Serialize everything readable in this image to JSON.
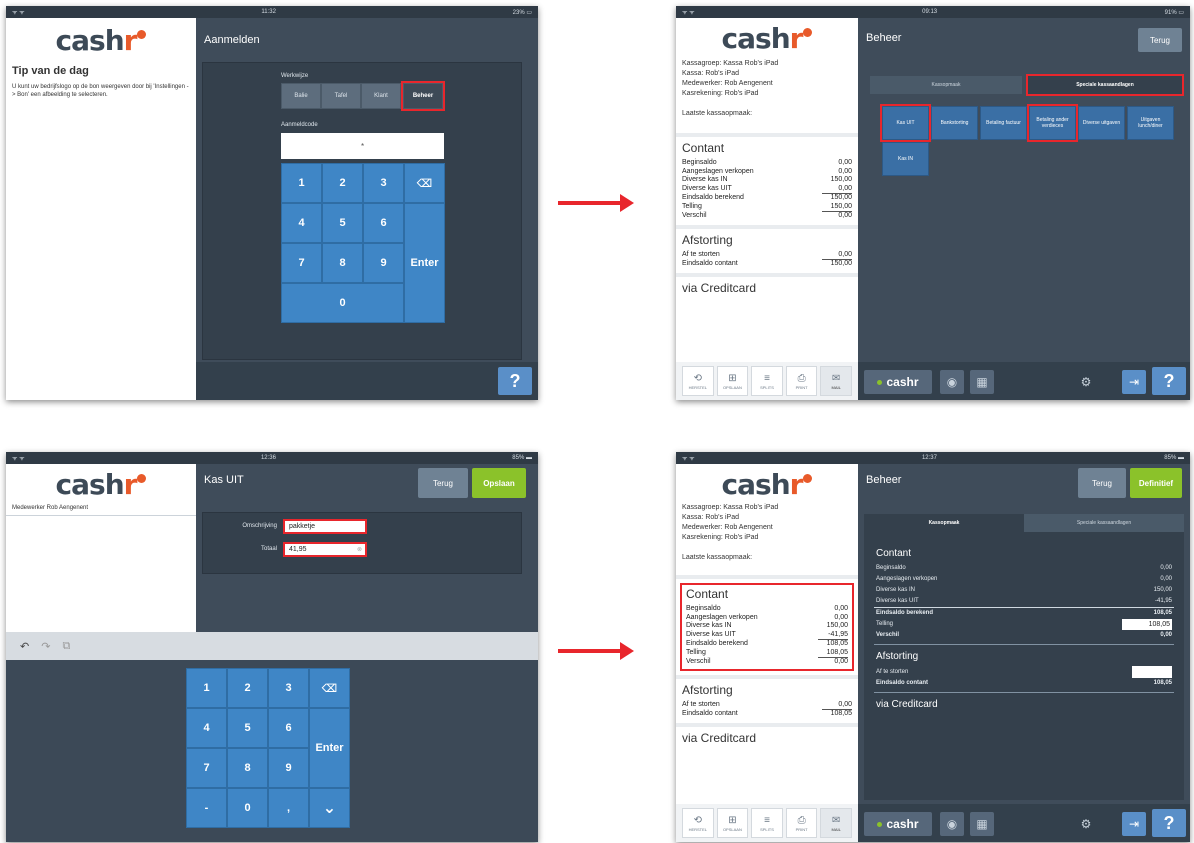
{
  "logo": {
    "text_main": "cash",
    "text_r": "r"
  },
  "arrows": [
    "arrow-1",
    "arrow-2"
  ],
  "s1": {
    "status": {
      "left": "ᯤ ᯤ",
      "time": "11:32",
      "battery": "23% ▭"
    },
    "tip_title": "Tip van de dag",
    "tip_text": "U kunt uw bedrijfslogo op de bon weergeven door bij 'Instellingen -> Bon' een afbeelding te selecteren.",
    "title": "Aanmelden",
    "werkwijze_label": "Werkwijze",
    "modes": [
      "Balie",
      "Tafel",
      "Klant",
      "Beheer"
    ],
    "aanmeldcode_label": "Aanmeldcode",
    "code_value": "*",
    "keys": [
      "1",
      "2",
      "3",
      "4",
      "5",
      "6",
      "7",
      "8",
      "9",
      "0"
    ],
    "enter": "Enter",
    "backspace": "⌫",
    "help": "?"
  },
  "s2": {
    "status": {
      "left": "ᯤ ᯤ",
      "time": "09:13",
      "battery": "91% ▭"
    },
    "info": [
      "Kassagroep: Kassa Rob's iPad",
      "Kassa: Rob's iPad",
      "Medewerker: Rob  Aengenent",
      "Kasrekening: Rob's iPad"
    ],
    "last": "Laatste kassaopmaak:",
    "contant_title": "Contant",
    "contant_rows": [
      {
        "label": "Beginsaldo",
        "value": "0,00"
      },
      {
        "label": "Aangeslagen verkopen",
        "value": "0,00"
      },
      {
        "label": "Diverse kas IN",
        "value": "150,00"
      },
      {
        "label": "Diverse kas UIT",
        "value": "0,00"
      },
      {
        "label": "Eindsaldo berekend",
        "value": "150,00"
      },
      {
        "label": "Telling",
        "value": "150,00"
      },
      {
        "label": "Verschil",
        "value": "0,00"
      }
    ],
    "afstorting_title": "Afstorting",
    "afstorting_rows": [
      {
        "label": "Af te storten",
        "value": "0,00"
      },
      {
        "label": "Eindsaldo contant",
        "value": "150,00"
      }
    ],
    "credit_title": "via Creditcard",
    "tools": [
      {
        "icon": "⟲",
        "label": "HERSTEL"
      },
      {
        "icon": "⊞",
        "label": "OPSLAAN"
      },
      {
        "icon": "≡",
        "label": "SPLITS"
      },
      {
        "icon": "⎙",
        "label": "PRINT"
      },
      {
        "icon": "✉",
        "label": "MAIL"
      }
    ],
    "title": "Beheer",
    "back": "Terug",
    "tabs": [
      "Kassopmaak",
      "Speciale kassaandlagen"
    ],
    "tiles": [
      "Kas UIT",
      "Bankstorting",
      "Betaling factuur",
      "Betaling ander verdieces",
      "Diverse uitgaven",
      "Uitgaven lunch/diner",
      "Kas IN"
    ],
    "brand": "cashr",
    "help": "?"
  },
  "s3": {
    "status": {
      "left": "ᯤ ᯤ",
      "time": "12:36",
      "battery": "85% ▬"
    },
    "employee": "Medewerker Rob Aengenent",
    "title": "Kas UIT",
    "back": "Terug",
    "save": "Opslaan",
    "omschrijving_label": "Omschrijving",
    "omschrijving_value": "pakketje",
    "totaal_label": "Totaal",
    "totaal_value": "41,95",
    "edit_icons": [
      "↶",
      "↷",
      "⧉"
    ],
    "keys": [
      "1",
      "2",
      "3",
      "4",
      "5",
      "6",
      "7",
      "8",
      "9",
      "-",
      "0",
      ","
    ],
    "enter": "Enter",
    "backspace": "⌫",
    "hide": "⌄"
  },
  "s4": {
    "status": {
      "left": "ᯤ ᯤ",
      "time": "12:37",
      "battery": "85% ▬"
    },
    "info": [
      "Kassagroep: Kassa Rob's iPad",
      "Kassa: Rob's iPad",
      "Medewerker: Rob  Aengenent",
      "Kasrekening: Rob's iPad"
    ],
    "last": "Laatste kassaopmaak:",
    "contant_title": "Contant",
    "contant_rows": [
      {
        "label": "Beginsaldo",
        "value": "0,00"
      },
      {
        "label": "Aangeslagen verkopen",
        "value": "0,00"
      },
      {
        "label": "Diverse kas IN",
        "value": "150,00"
      },
      {
        "label": "Diverse kas UIT",
        "value": "-41,95"
      },
      {
        "label": "Eindsaldo berekend",
        "value": "108,05"
      },
      {
        "label": "Telling",
        "value": "108,05"
      },
      {
        "label": "Verschil",
        "value": "0,00"
      }
    ],
    "afstorting_title": "Afstorting",
    "afstorting_rows": [
      {
        "label": "Af te storten",
        "value": "0,00"
      },
      {
        "label": "Eindsaldo contant",
        "value": "108,05"
      }
    ],
    "credit_title": "via Creditcard",
    "tools": [
      {
        "icon": "⟲",
        "label": "HERSTEL"
      },
      {
        "icon": "⊞",
        "label": "OPSLAAN"
      },
      {
        "icon": "≡",
        "label": "SPLITS"
      },
      {
        "icon": "⎙",
        "label": "PRINT"
      },
      {
        "icon": "✉",
        "label": "MAIL"
      }
    ],
    "title": "Beheer",
    "back": "Terug",
    "final": "Definitief",
    "tabs": [
      "Kassopmaak",
      "Speciale kassaandlagen"
    ],
    "dark_title": "Contant",
    "dark_rows": [
      {
        "label": "Beginsaldo",
        "value": "0,00"
      },
      {
        "label": "Aangeslagen verkopen",
        "value": "0,00"
      },
      {
        "label": "Diverse kas IN",
        "value": "150,00"
      },
      {
        "label": "Diverse kas UIT",
        "value": "-41,95"
      },
      {
        "label": "Eindsaldo berekend",
        "value": "108,05"
      },
      {
        "label": "Telling",
        "value": "108,05"
      },
      {
        "label": "Verschil",
        "value": "0,00"
      }
    ],
    "dark_afstorting_title": "Afstorting",
    "dark_af_label": "Af te storten",
    "dark_eind_label": "Eindsaldo contant",
    "dark_eind_value": "108,05",
    "dark_credit_title": "via Creditcard",
    "brand": "cashr",
    "help": "?"
  }
}
